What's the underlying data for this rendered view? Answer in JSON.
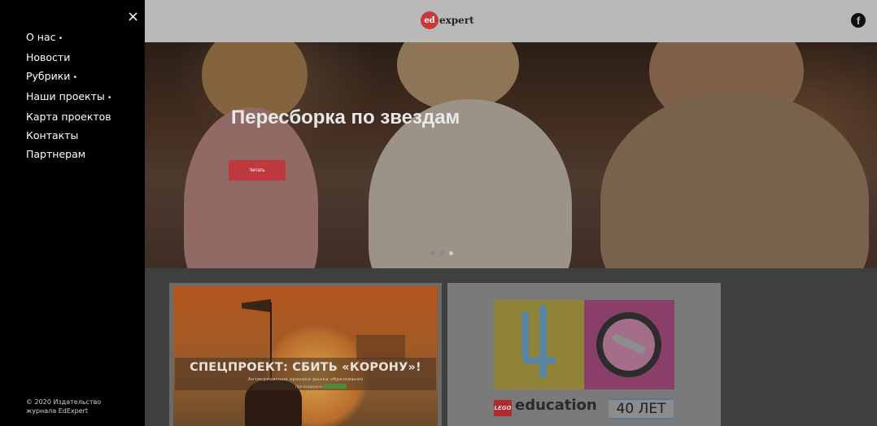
{
  "sidebar": {
    "close_icon": "×",
    "menu": [
      {
        "label": "О нас",
        "has_submenu": true
      },
      {
        "label": "Новости",
        "has_submenu": false
      },
      {
        "label": "Рубрики",
        "has_submenu": true
      },
      {
        "label": "Наши проекты",
        "has_submenu": true
      },
      {
        "label": "Карта проектов",
        "has_submenu": false
      },
      {
        "label": "Контакты",
        "has_submenu": false
      },
      {
        "label": "Партнерам",
        "has_submenu": false
      }
    ],
    "submenu_marker": "•",
    "copyright_line1": "© 2020 Издательство",
    "copyright_line2": "журнала EdExpert"
  },
  "header": {
    "logo_ed": "ed",
    "logo_rest": "expert",
    "facebook_glyph": "f"
  },
  "hero": {
    "title": "Пересборка по звездам",
    "button_label": "Читать",
    "slide_count": 3,
    "active_slide": 3,
    "button_color": "#c0393f"
  },
  "cards": {
    "special": {
      "title": "СПЕЦПРОЕКТ: СБИТЬ «КОРОНУ»!",
      "subtitle": "Антикризисные хроники рынка образования",
      "support": "При поддержке"
    },
    "lego": {
      "logo": "LEGO",
      "brand": "education",
      "years": "40 ЛЕТ"
    }
  },
  "icons": {
    "close": "close-icon",
    "facebook": "facebook-icon"
  }
}
